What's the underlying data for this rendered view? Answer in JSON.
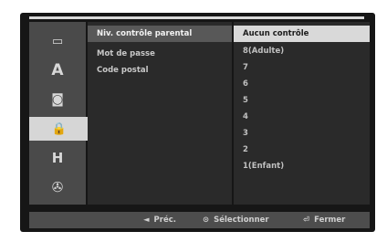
{
  "sidebar": {
    "icons": [
      {
        "name": "disc-settings-icon",
        "glyph": "▭"
      },
      {
        "name": "language-icon",
        "glyph": "A"
      },
      {
        "name": "audio-icon",
        "glyph": "◙"
      },
      {
        "name": "lock-icon",
        "glyph": "🔒"
      },
      {
        "name": "recording-icon",
        "glyph": "H"
      },
      {
        "name": "disc-icon",
        "glyph": "✇"
      }
    ],
    "active_index": 3
  },
  "menu": {
    "items": [
      "Niv. contrôle parental",
      "Mot de passe",
      "Code postal"
    ],
    "selected_index": 0
  },
  "options": {
    "items": [
      "Aucun contrôle",
      "8(Adulte)",
      "7",
      "6",
      "5",
      "4",
      "3",
      "2",
      "1(Enfant)"
    ],
    "selected_index": 0
  },
  "footer": {
    "prev_glyph": "◄",
    "prev_label": "Préc.",
    "select_glyph": "⊙",
    "select_label": "Sélectionner",
    "close_glyph": "⏎",
    "close_label": "Fermer"
  },
  "colors": {
    "screen_bg": "#161616",
    "panel_bg": "#2a2a2a",
    "highlight_light": "#d9d9d9",
    "highlight_dark": "#585858",
    "bar_bg": "#4d4d4d"
  }
}
